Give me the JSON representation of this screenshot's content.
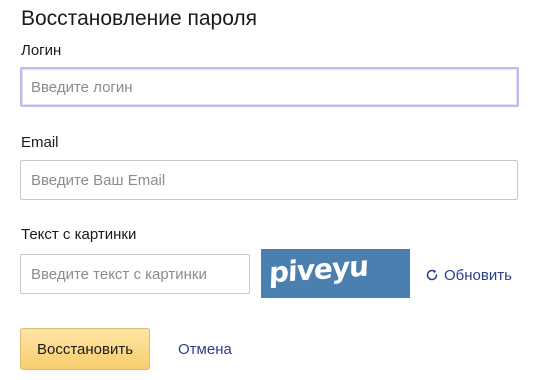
{
  "form": {
    "title": "Восстановление пароля",
    "login": {
      "label": "Логин",
      "placeholder": "Введите логин",
      "value": ""
    },
    "email": {
      "label": "Email",
      "placeholder": "Введите Ваш Email",
      "value": ""
    },
    "captcha": {
      "label": "Текст с картинки",
      "placeholder": "Введите текст с картинки",
      "value": "",
      "image_text": "piveyu",
      "image_background": "#4a7fb0",
      "refresh_label": "Обновить",
      "refresh_icon": "refresh-icon"
    },
    "submit_label": "Восстановить",
    "cancel_label": "Отмена"
  },
  "colors": {
    "link": "#2b3f8c",
    "button_top": "#fde6a6",
    "button_bottom": "#f9cd6d",
    "focus_border": "#c9b8eb"
  }
}
